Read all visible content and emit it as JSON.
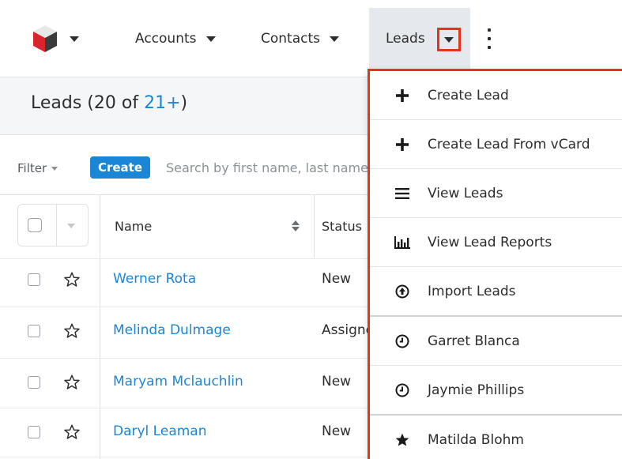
{
  "nav": {
    "items": [
      {
        "label": "Accounts"
      },
      {
        "label": "Contacts"
      },
      {
        "label": "Leads"
      }
    ]
  },
  "list": {
    "title_prefix": "Leads (20 of ",
    "title_count": "21+",
    "title_suffix": ")"
  },
  "filter": {
    "filter_label": "Filter",
    "create_label": "Create",
    "search_placeholder": "Search by first name, last name..."
  },
  "table": {
    "columns": [
      "Name",
      "Status"
    ],
    "rows": [
      {
        "name": "Werner Rota",
        "status": "New"
      },
      {
        "name": "Melinda Dulmage",
        "status": "Assigned"
      },
      {
        "name": "Maryam Mclauchlin",
        "status": "New"
      },
      {
        "name": "Daryl Leaman",
        "status": "New"
      }
    ]
  },
  "dropdown": {
    "items": [
      {
        "label": "Create Lead",
        "icon": "plus-icon"
      },
      {
        "label": "Create Lead From vCard",
        "icon": "plus-icon"
      },
      {
        "label": "View Leads",
        "icon": "list-icon"
      },
      {
        "label": "View Lead Reports",
        "icon": "bar-chart-icon"
      },
      {
        "label": "Import Leads",
        "icon": "upload-circle-icon"
      },
      {
        "label": "Garret Blanca",
        "icon": "clock-icon"
      },
      {
        "label": "Jaymie Phillips",
        "icon": "clock-icon"
      },
      {
        "label": "Matilda Blohm",
        "icon": "star-filled-icon"
      }
    ]
  },
  "colors": {
    "accent": "#1c86d6",
    "highlight_border": "#e8331a",
    "active_tab_bg": "#e5e8ec"
  }
}
